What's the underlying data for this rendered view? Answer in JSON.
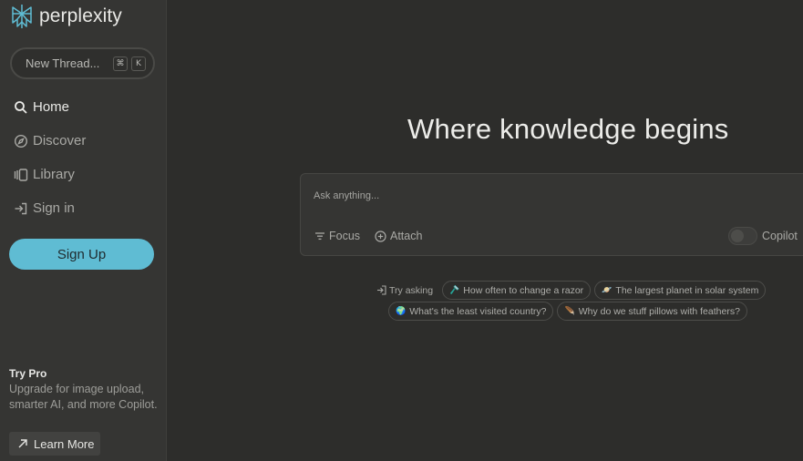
{
  "brand": {
    "name": "perplexity"
  },
  "sidebar": {
    "new_thread": {
      "label": "New Thread...",
      "shortcut_keys": [
        "⌘",
        "K"
      ]
    },
    "nav": [
      {
        "label": "Home",
        "icon": "search-icon",
        "active": true
      },
      {
        "label": "Discover",
        "icon": "compass-icon",
        "active": false
      },
      {
        "label": "Library",
        "icon": "library-icon",
        "active": false
      },
      {
        "label": "Sign in",
        "icon": "sign-in-icon",
        "active": false
      }
    ],
    "sign_up": "Sign Up",
    "pro": {
      "title": "Try Pro",
      "description": "Upgrade for image upload, smarter AI, and more Copilot.",
      "learn_more": "Learn More"
    }
  },
  "main": {
    "headline": "Where knowledge begins",
    "ask": {
      "placeholder": "Ask anything...",
      "focus_label": "Focus",
      "attach_label": "Attach",
      "copilot_label": "Copilot",
      "copilot_on": false
    },
    "suggestions": {
      "try_label": "Try asking",
      "items": [
        {
          "emoji": "🪒",
          "label": "How often to change a razor"
        },
        {
          "emoji": "🪐",
          "label": "The largest planet in solar system"
        },
        {
          "emoji": "🌍",
          "label": "What's the least visited country?"
        },
        {
          "emoji": "🪶",
          "label": "Why do we stuff pillows with feathers?"
        }
      ]
    }
  },
  "colors": {
    "background": "#2d2d2b",
    "sidebar": "#353533",
    "accent": "#5fbcd3",
    "text": "#e8e8e6",
    "muted_text": "#a9a9a5"
  }
}
